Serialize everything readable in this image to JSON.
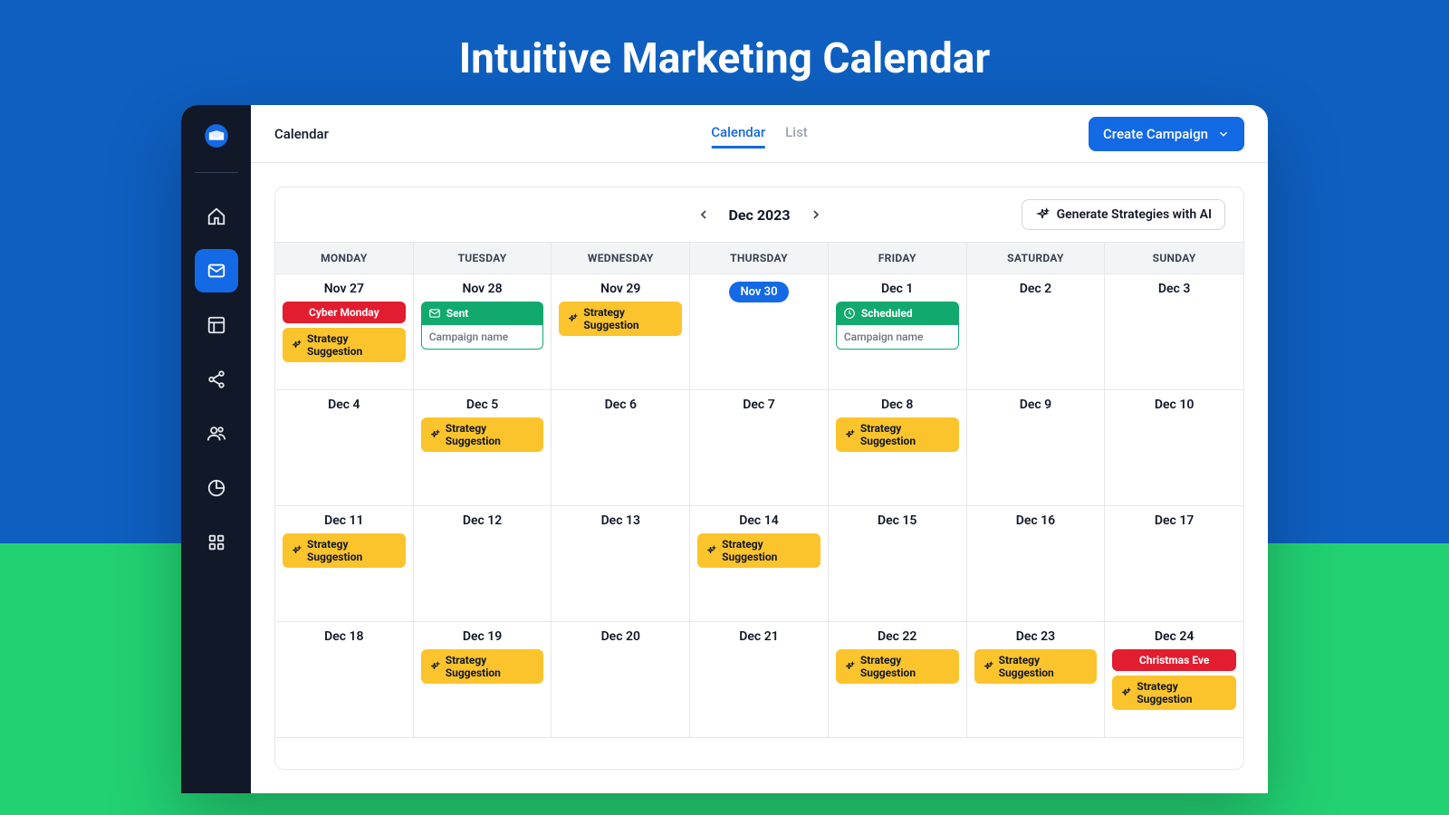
{
  "hero": {
    "title": "Intuitive Marketing Calendar"
  },
  "breadcrumb": "Calendar",
  "tabs": {
    "calendar": "Calendar",
    "list": "List"
  },
  "create_button": "Create Campaign",
  "month_label": "Dec 2023",
  "generate_button": "Generate Strategies with AI",
  "day_names": [
    "MONDAY",
    "TUESDAY",
    "WEDNESDAY",
    "THURSDAY",
    "FRIDAY",
    "SATURDAY",
    "SUNDAY"
  ],
  "labels": {
    "strategy_suggestion": "Strategy Suggestion",
    "cyber_monday": "Cyber Monday",
    "sent": "Sent",
    "scheduled": "Scheduled",
    "campaign_name": "Campaign name",
    "christmas_eve": "Christmas Eve"
  },
  "weeks": [
    [
      {
        "date": "Nov 27",
        "today": false,
        "items": [
          {
            "type": "red",
            "key": "cyber_monday"
          },
          {
            "type": "yellow",
            "key": "strategy_suggestion"
          }
        ]
      },
      {
        "date": "Nov 28",
        "today": false,
        "items": [
          {
            "type": "green",
            "head_key": "sent",
            "body_key": "campaign_name"
          }
        ]
      },
      {
        "date": "Nov 29",
        "today": false,
        "items": [
          {
            "type": "yellow",
            "key": "strategy_suggestion"
          }
        ]
      },
      {
        "date": "Nov 30",
        "today": true,
        "items": []
      },
      {
        "date": "Dec 1",
        "today": false,
        "items": [
          {
            "type": "green",
            "head_key": "scheduled",
            "body_key": "campaign_name",
            "clock": true
          }
        ]
      },
      {
        "date": "Dec 2",
        "today": false,
        "items": []
      },
      {
        "date": "Dec 3",
        "today": false,
        "items": []
      }
    ],
    [
      {
        "date": "Dec 4",
        "today": false,
        "items": []
      },
      {
        "date": "Dec 5",
        "today": false,
        "items": [
          {
            "type": "yellow",
            "key": "strategy_suggestion"
          }
        ]
      },
      {
        "date": "Dec 6",
        "today": false,
        "items": []
      },
      {
        "date": "Dec 7",
        "today": false,
        "items": []
      },
      {
        "date": "Dec 8",
        "today": false,
        "items": [
          {
            "type": "yellow",
            "key": "strategy_suggestion"
          }
        ]
      },
      {
        "date": "Dec 9",
        "today": false,
        "items": []
      },
      {
        "date": "Dec 10",
        "today": false,
        "items": []
      }
    ],
    [
      {
        "date": "Dec 11",
        "today": false,
        "items": [
          {
            "type": "yellow",
            "key": "strategy_suggestion"
          }
        ]
      },
      {
        "date": "Dec 12",
        "today": false,
        "items": []
      },
      {
        "date": "Dec 13",
        "today": false,
        "items": []
      },
      {
        "date": "Dec 14",
        "today": false,
        "items": [
          {
            "type": "yellow",
            "key": "strategy_suggestion"
          }
        ]
      },
      {
        "date": "Dec 15",
        "today": false,
        "items": []
      },
      {
        "date": "Dec 16",
        "today": false,
        "items": []
      },
      {
        "date": "Dec 17",
        "today": false,
        "items": []
      }
    ],
    [
      {
        "date": "Dec 18",
        "today": false,
        "items": []
      },
      {
        "date": "Dec 19",
        "today": false,
        "items": [
          {
            "type": "yellow",
            "key": "strategy_suggestion"
          }
        ]
      },
      {
        "date": "Dec 20",
        "today": false,
        "items": []
      },
      {
        "date": "Dec 21",
        "today": false,
        "items": []
      },
      {
        "date": "Dec 22",
        "today": false,
        "items": [
          {
            "type": "yellow",
            "key": "strategy_suggestion"
          }
        ]
      },
      {
        "date": "Dec 23",
        "today": false,
        "items": [
          {
            "type": "yellow",
            "key": "strategy_suggestion"
          }
        ]
      },
      {
        "date": "Dec 24",
        "today": false,
        "items": [
          {
            "type": "red",
            "key": "christmas_eve"
          },
          {
            "type": "yellow",
            "key": "strategy_suggestion"
          }
        ]
      }
    ]
  ]
}
